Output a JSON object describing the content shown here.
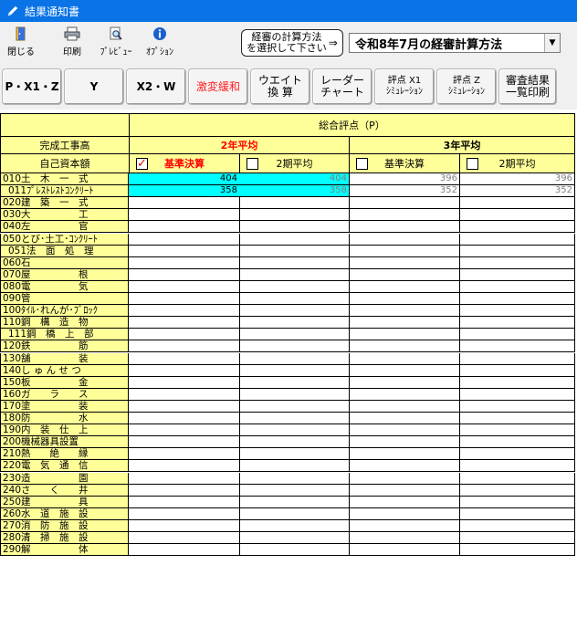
{
  "window": {
    "title": "結果通知書"
  },
  "toolbar": {
    "close": "閉じる",
    "print": "印刷",
    "preview": "ﾌﾟﾚﾋﾞｭｰ",
    "option": "ｵﾌﾟｼｮﾝ",
    "calc_method_btn": "経審の計算方法\nを選択して下さい",
    "calc_arrow": "⇒",
    "calc_method_value": "令和8年7月の経審計算方法"
  },
  "buttons": [
    "P・X1・Z",
    "Y",
    "X2・W",
    "激変緩和",
    "ウエイト\n換 算",
    "レーダー\nチャート",
    "評点 X1\nｼﾐｭﾚｰｼｮﾝ",
    "評点 Z\nｼﾐｭﾚｰｼｮﾝ",
    "審査結果\n一覧印刷"
  ],
  "grid": {
    "total_header": "総合評点（P）",
    "completed_work": "完成工事高",
    "own_capital": "自己資本額",
    "avg2": "2年平均",
    "avg3": "3年平均",
    "base_settlement": "基準決算",
    "period_avg": "2期平均",
    "base_settlement_3": "基準決算",
    "period_avg_3": "2期平均",
    "rows": [
      {
        "code": "010",
        "name": "土　木　一　式",
        "v": [
          "404",
          "404",
          "396",
          "396"
        ]
      },
      {
        "code": "011",
        "name": "ﾌﾟﾚｽﾄﾚｽﾄｺﾝｸﾘｰﾄ",
        "v": [
          "358",
          "358",
          "352",
          "352"
        ]
      },
      {
        "code": "020",
        "name": "建　築　一　式",
        "v": [
          "",
          "",
          "",
          ""
        ]
      },
      {
        "code": "030",
        "name": "大　　　　　工",
        "v": [
          "",
          "",
          "",
          ""
        ]
      },
      {
        "code": "040",
        "name": "左　　　　　官",
        "v": [
          "",
          "",
          "",
          ""
        ]
      },
      {
        "code": "050",
        "name": "とび･土工･ｺﾝｸﾘｰﾄ",
        "v": [
          "",
          "",
          "",
          ""
        ]
      },
      {
        "code": "051",
        "name": "法　面　処　理",
        "v": [
          "",
          "",
          "",
          ""
        ]
      },
      {
        "code": "060",
        "name": "石",
        "v": [
          "",
          "",
          "",
          ""
        ]
      },
      {
        "code": "070",
        "name": "屋　　　　　根",
        "v": [
          "",
          "",
          "",
          ""
        ]
      },
      {
        "code": "080",
        "name": "電　　　　　気",
        "v": [
          "",
          "",
          "",
          ""
        ]
      },
      {
        "code": "090",
        "name": "管",
        "v": [
          "",
          "",
          "",
          ""
        ]
      },
      {
        "code": "100",
        "name": "ﾀｲﾙ･れんが･ﾌﾞﾛｯｸ",
        "v": [
          "",
          "",
          "",
          ""
        ]
      },
      {
        "code": "110",
        "name": "鋼　構　造　物",
        "v": [
          "",
          "",
          "",
          ""
        ]
      },
      {
        "code": "111",
        "name": "鋼　橋　上　部",
        "v": [
          "",
          "",
          "",
          ""
        ]
      },
      {
        "code": "120",
        "name": "鉄　　　　　筋",
        "v": [
          "",
          "",
          "",
          ""
        ]
      },
      {
        "code": "130",
        "name": "舗　　　　　装",
        "v": [
          "",
          "",
          "",
          ""
        ]
      },
      {
        "code": "140",
        "name": "し ゅ ん せ つ",
        "v": [
          "",
          "",
          "",
          ""
        ]
      },
      {
        "code": "150",
        "name": "板　　　　　金",
        "v": [
          "",
          "",
          "",
          ""
        ]
      },
      {
        "code": "160",
        "name": "ガ　　ラ　　ス",
        "v": [
          "",
          "",
          "",
          ""
        ]
      },
      {
        "code": "170",
        "name": "塗　　　　　装",
        "v": [
          "",
          "",
          "",
          ""
        ]
      },
      {
        "code": "180",
        "name": "防　　　　　水",
        "v": [
          "",
          "",
          "",
          ""
        ]
      },
      {
        "code": "190",
        "name": "内　装　仕　上",
        "v": [
          "",
          "",
          "",
          ""
        ]
      },
      {
        "code": "200",
        "name": "機械器具設置",
        "v": [
          "",
          "",
          "",
          ""
        ]
      },
      {
        "code": "210",
        "name": "熱　　絶　　縁",
        "v": [
          "",
          "",
          "",
          ""
        ]
      },
      {
        "code": "220",
        "name": "電　気　通　信",
        "v": [
          "",
          "",
          "",
          ""
        ]
      },
      {
        "code": "230",
        "name": "造　　　　　園",
        "v": [
          "",
          "",
          "",
          ""
        ]
      },
      {
        "code": "240",
        "name": "さ　　く　　井",
        "v": [
          "",
          "",
          "",
          ""
        ]
      },
      {
        "code": "250",
        "name": "建　　　　　具",
        "v": [
          "",
          "",
          "",
          ""
        ]
      },
      {
        "code": "260",
        "name": "水　道　施　設",
        "v": [
          "",
          "",
          "",
          ""
        ]
      },
      {
        "code": "270",
        "name": "消　防　施　設",
        "v": [
          "",
          "",
          "",
          ""
        ]
      },
      {
        "code": "280",
        "name": "清　掃　施　設",
        "v": [
          "",
          "",
          "",
          ""
        ]
      },
      {
        "code": "290",
        "name": "解　　　　　体",
        "v": [
          "",
          "",
          "",
          ""
        ]
      }
    ]
  },
  "colors": {
    "header_yellow": "#ffff99",
    "teal": "#00ffff",
    "title_blue": "#0a74e6",
    "red": "#ff0000"
  }
}
